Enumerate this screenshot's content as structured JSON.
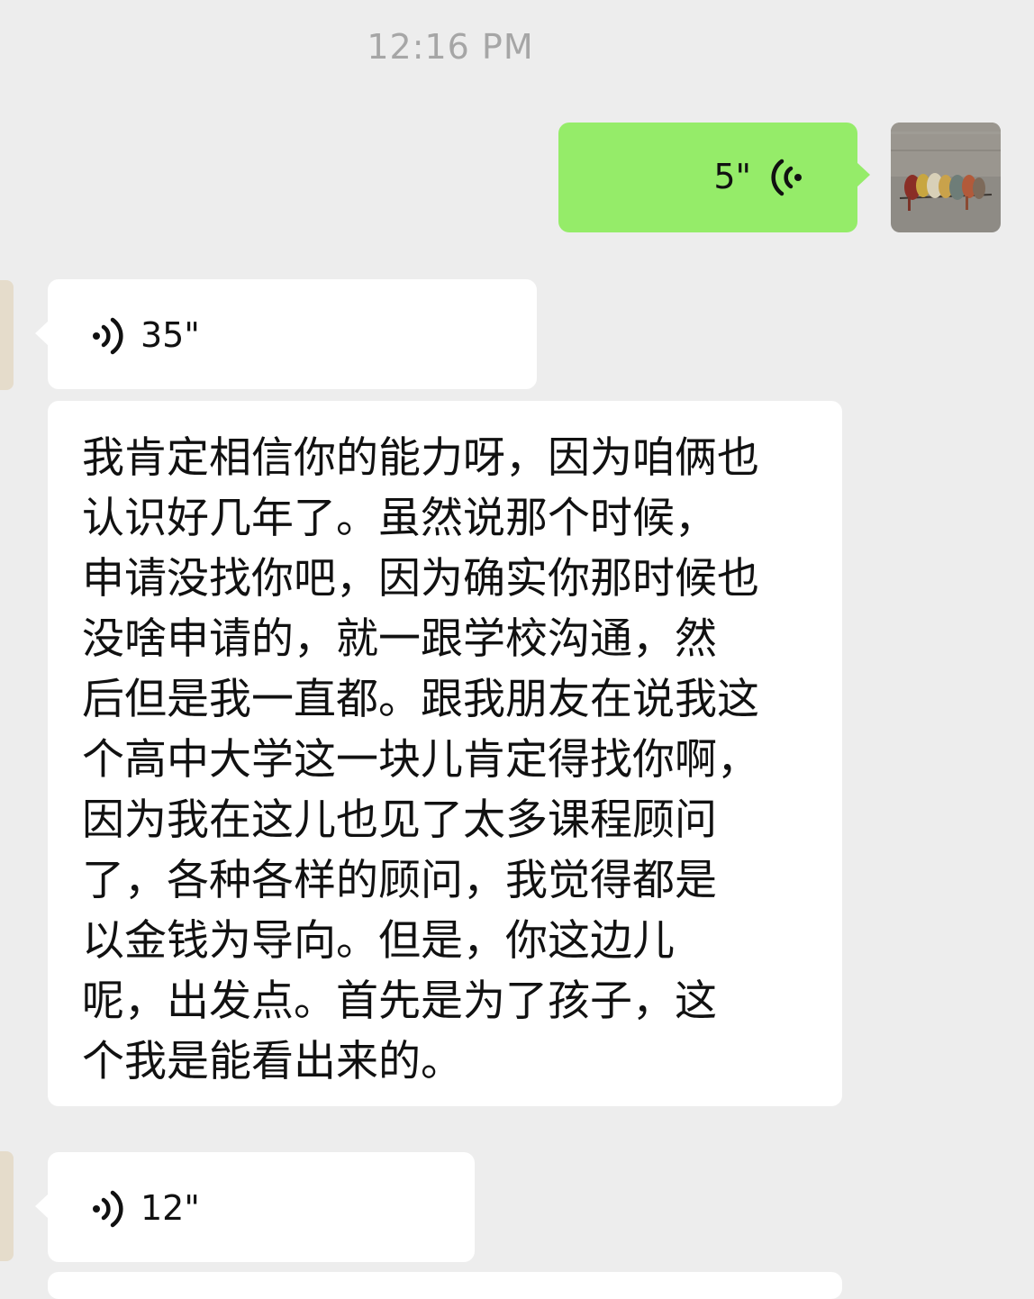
{
  "chat": {
    "timestamp": "12:16 PM",
    "colors": {
      "background": "#ededed",
      "outgoing_bubble": "#95ec69",
      "incoming_bubble": "#ffffff",
      "timestamp_text": "#a6a6a6"
    },
    "messages": [
      {
        "direction": "outgoing",
        "type": "voice",
        "duration": "5\"",
        "icon": "voice-wave-icon"
      },
      {
        "direction": "incoming",
        "type": "voice",
        "duration": "35\"",
        "icon": "voice-wave-icon"
      },
      {
        "direction": "incoming",
        "type": "text",
        "lines": [
          "我肯定相信你的能力呀，因为咱俩也",
          "认识好几年了。虽然说那个时候，",
          "申请没找你吧，因为确实你那时候也",
          "没啥申请的，就一跟学校沟通，然",
          "后但是我一直都。跟我朋友在说我这",
          "个高中大学这一块儿肯定得找你啊，",
          "因为我在这儿也见了太多课程顾问",
          "了，各种各样的顾问，我觉得都是",
          "以金钱为导向。但是，你这边儿",
          "呢，出发点。首先是为了孩子，这",
          "个我是能看出来的。"
        ]
      },
      {
        "direction": "incoming",
        "type": "voice",
        "duration": "12\"",
        "icon": "voice-wave-icon"
      }
    ]
  }
}
